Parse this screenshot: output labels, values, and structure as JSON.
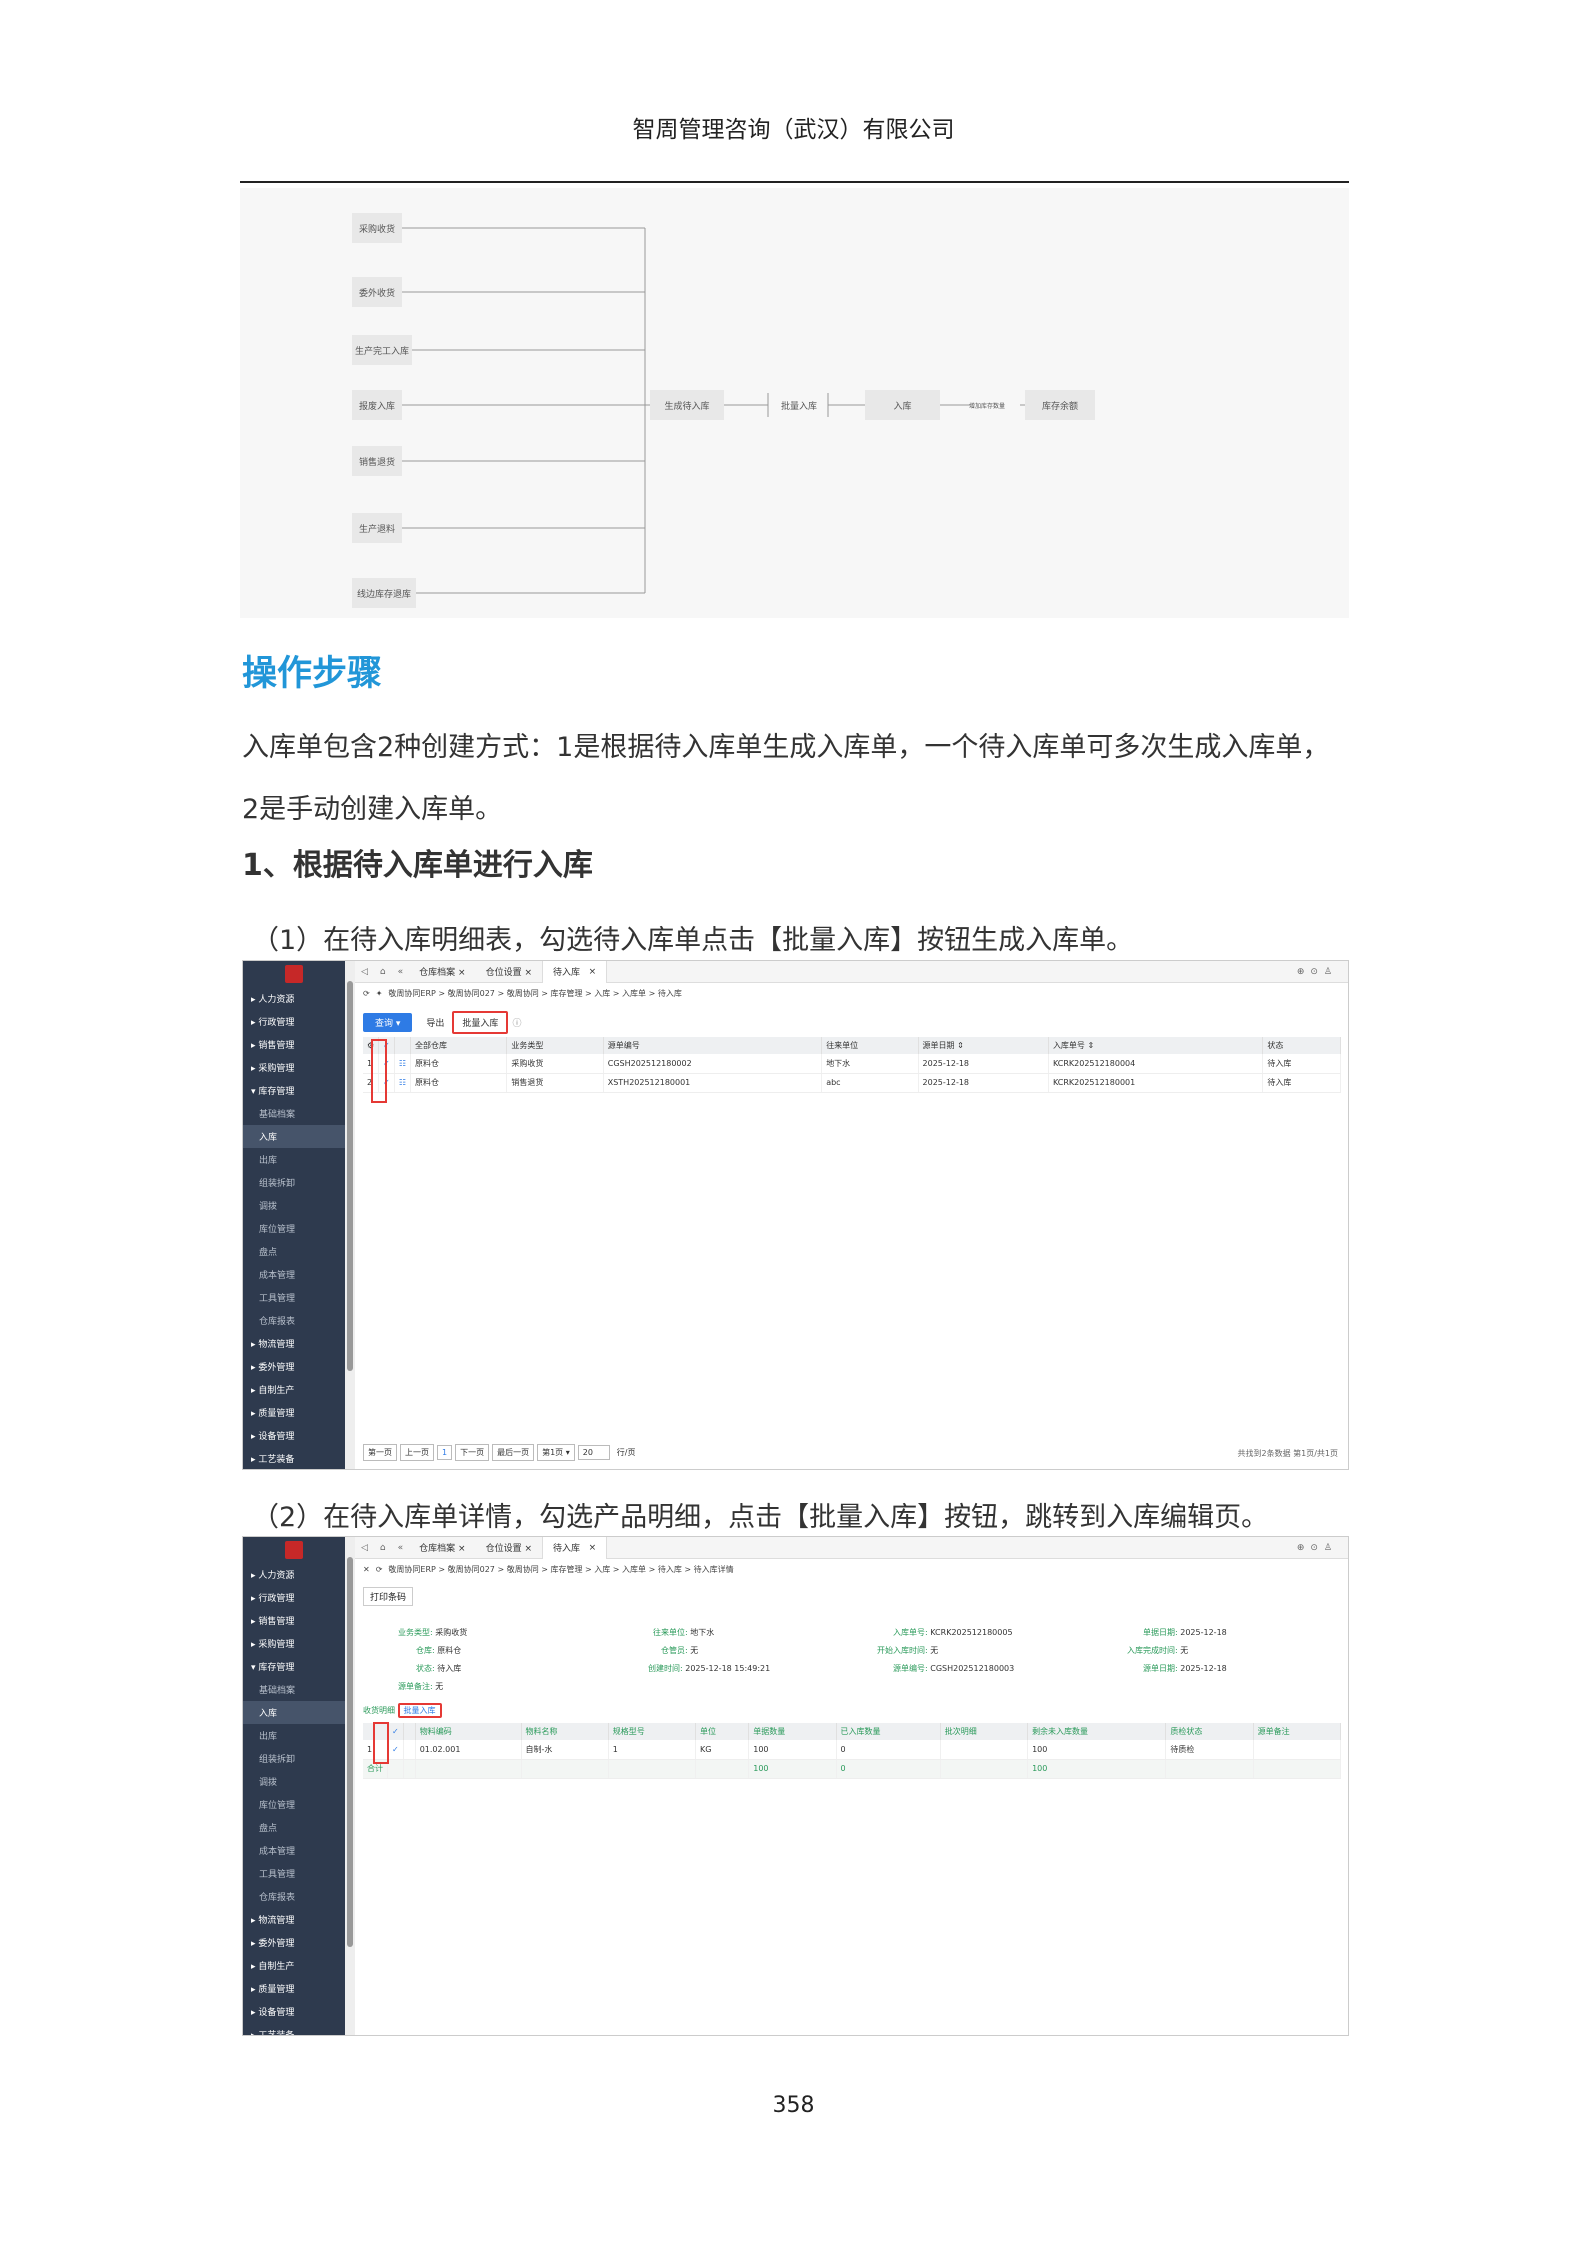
{
  "header": {
    "company": "智周管理咨询（武汉）有限公司"
  },
  "flow": {
    "sources": [
      "采购收货",
      "委外收货",
      "生产完工入库",
      "报废入库",
      "销售退货",
      "生产退料",
      "线边库存退库"
    ],
    "pending": "生成待入库",
    "batch": "批量入库",
    "inbound": "入库",
    "edge_label": "增加库存数量",
    "balance": "库存余额"
  },
  "section": {
    "title": "操作步骤",
    "intro_line1": "入库单包含2种创建方式：1是根据待入库单生成入库单，一个待入库单可多次生成入库单，",
    "intro_line2": "2是手动创建入库单。",
    "sub_title": "1、根据待入库单进行入库",
    "step1": "（1）在待入库明细表，勾选待入库单点击【批量入库】按钮生成入库单。",
    "step2": "（2）在待入库单详情，勾选产品明细，点击【批量入库】按钮，跳转到入库编辑页。"
  },
  "sidebar": {
    "items": [
      {
        "label": "▸ 人力资源"
      },
      {
        "label": "▸ 行政管理"
      },
      {
        "label": "▸ 销售管理"
      },
      {
        "label": "▸ 采购管理"
      },
      {
        "label": "▾ 库存管理"
      },
      {
        "label": "基础档案"
      },
      {
        "label": "入库"
      },
      {
        "label": "出库"
      },
      {
        "label": "组装拆卸"
      },
      {
        "label": "调拨"
      },
      {
        "label": "库位管理"
      },
      {
        "label": "盘点"
      },
      {
        "label": "成本管理"
      },
      {
        "label": "工具管理"
      },
      {
        "label": "仓库报表"
      },
      {
        "label": "▸ 物流管理"
      },
      {
        "label": "▸ 委外管理"
      },
      {
        "label": "▸ 自制生产"
      },
      {
        "label": "▸ 质量管理"
      },
      {
        "label": "▸ 设备管理"
      },
      {
        "label": "▸ 工艺装备"
      }
    ]
  },
  "shot1": {
    "tabs": [
      "仓库档案",
      "仓位设置",
      "待入库"
    ],
    "breadcrumb": "敬周协同ERP > 敬周协同027 > 敬周协同 > 库存管理 > 入库 > 入库单 > 待入库",
    "toolbar": {
      "query": "查询",
      "export": "导出",
      "batch": "批量入库"
    },
    "columns": [
      "全部仓库",
      "业务类型",
      "源单编号",
      "往来单位",
      "源单日期 ⇕",
      "入库单号 ⇕",
      "状态"
    ],
    "rows": [
      {
        "no": "1",
        "cells": [
          "原料仓",
          "采购收货",
          "CGSH202512180002",
          "地下水",
          "2025-12-18",
          "KCRK202512180004",
          "待入库"
        ]
      },
      {
        "no": "2",
        "cells": [
          "原料仓",
          "销售退货",
          "XSTH202512180001",
          "abc",
          "2025-12-18",
          "KCRK202512180001",
          "待入库"
        ]
      }
    ],
    "pager": {
      "first": "第一页",
      "prev": "上一页",
      "page": "1",
      "next": "下一页",
      "last": "最后一页",
      "select": "第1页 ▾",
      "size": "20",
      "unit": "行/页"
    },
    "pager_info": "共找到2条数据 第1页/共1页"
  },
  "shot2": {
    "tabs": [
      "仓库档案",
      "仓位设置",
      "待入库"
    ],
    "breadcrumb": "敬周协同ERP > 敬周协同027 > 敬周协同 > 库存管理 > 入库 > 入库单 > 待入库 > 待入库详情",
    "print_btn": "打印条码",
    "form": [
      {
        "label": "业务类型:",
        "value": "采购收货"
      },
      {
        "label": "往来单位:",
        "value": "地下水"
      },
      {
        "label": "入库单号:",
        "value": "KCRK202512180005"
      },
      {
        "label": "单据日期:",
        "value": "2025-12-18"
      },
      {
        "label": "仓库:",
        "value": "原料仓"
      },
      {
        "label": "仓管员:",
        "value": "无"
      },
      {
        "label": "开始入库时间:",
        "value": "无"
      },
      {
        "label": "入库完成时间:",
        "value": "无"
      },
      {
        "label": "状态:",
        "value": "待入库"
      },
      {
        "label": "创建时间:",
        "value": "2025-12-18 15:49:21"
      },
      {
        "label": "源单编号:",
        "value": "CGSH202512180003"
      },
      {
        "label": "源单日期:",
        "value": "2025-12-18"
      },
      {
        "label": "源单备注:",
        "value": "无"
      }
    ],
    "detail_tab": "收货明细",
    "batch_btn": "批量入库",
    "columns": [
      "物料编码",
      "物料名称",
      "规格型号",
      "单位",
      "单据数量",
      "已入库数量",
      "批次明细",
      "剩余未入库数量",
      "质检状态",
      "源单备注"
    ],
    "row": {
      "no": "1",
      "cells": [
        "01.02.001",
        "自制-水",
        "1",
        "KG",
        "100",
        "0",
        "",
        "100",
        "待质检",
        ""
      ]
    },
    "total": {
      "label": "合计",
      "qty": "100",
      "done": "0",
      "remain": "100"
    }
  },
  "page_number": "358"
}
